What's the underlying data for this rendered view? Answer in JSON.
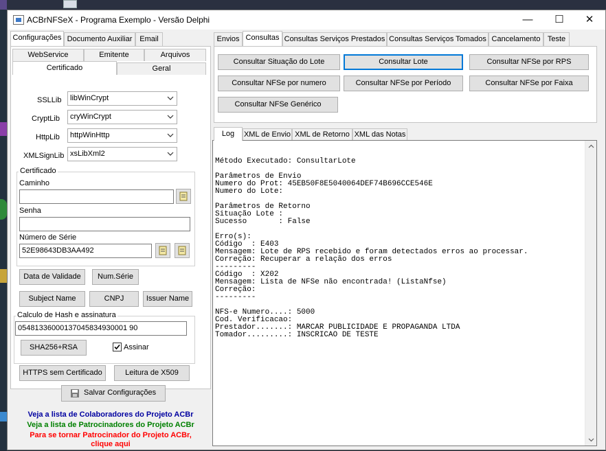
{
  "window": {
    "title": "ACBrNFSeX - Programa Exemplo - Versão Delphi",
    "minimize_glyph": "—",
    "maximize_glyph": "☐",
    "close_glyph": "✕"
  },
  "left": {
    "tabs": [
      "Configurações",
      "Documento Auxiliar",
      "Email"
    ],
    "subtabs_row1": [
      "WebService",
      "Emitente",
      "Arquivos"
    ],
    "subtabs_row2": [
      "Certificado",
      "Geral"
    ],
    "ssllib": {
      "label": "SSLLib",
      "value": "libWinCrypt"
    },
    "cryptlib": {
      "label": "CryptLib",
      "value": "cryWinCrypt"
    },
    "httplib": {
      "label": "HttpLib",
      "value": "httpWinHttp"
    },
    "xmlsignlib": {
      "label": "XMLSignLib",
      "value": "xsLibXml2"
    },
    "cert_group": "Certificado",
    "caminho_label": "Caminho",
    "caminho_value": "",
    "senha_label": "Senha",
    "senha_value": "",
    "serie_label": "Número de Série",
    "serie_value": "52E98643DB3AA492",
    "btn_validade": "Data de Validade",
    "btn_numserie": "Num.Série",
    "btn_subject": "Subject Name",
    "btn_cnpj": "CNPJ",
    "btn_issuer": "Issuer Name",
    "hash_group": "Calculo de Hash e assinatura",
    "hash_value": "05481336000137045834930001 90",
    "btn_sha": "SHA256+RSA",
    "assinar_label": "Assinar",
    "btn_https": "HTTPS sem Certificado",
    "btn_x509": "Leitura de X509",
    "btn_salvar": "Salvar Configurações",
    "link1": "Veja a lista de Colaboradores do Projeto ACBr",
    "link2": "Veja a lista de Patrocinadores do Projeto ACBr",
    "link3a": "Para se tornar Patrocinador do Projeto ACBr,",
    "link3b": "clique aqui"
  },
  "colors": {
    "link1": "#0000a0",
    "link2": "#008000",
    "link3": "#ff0000",
    "accent": "#0078d7"
  },
  "right": {
    "tabs": [
      "Envios",
      "Consultas",
      "Consultas Serviços Prestados",
      "Consultas Serviços Tomados",
      "Cancelamento",
      "Teste"
    ],
    "buttons": [
      "Consultar Situação do Lote",
      "Consultar Lote",
      "Consultar NFSe por RPS",
      "Consultar NFSe por numero",
      "Consultar NFSe por Período",
      "Consultar NFSe por Faixa",
      "Consultar NFSe Genérico"
    ],
    "log_tabs": [
      "Log",
      "XML de Envio",
      "XML de Retorno",
      "XML das Notas"
    ],
    "log_lines": [
      "Método Executado: ConsultarLote",
      "",
      "Parâmetros de Envio",
      "Numero do Prot: 45EB50F8E5040064DEF74B696CCE546E",
      "Numero do Lote:",
      "",
      "Parâmetros de Retorno",
      "Situação Lote :",
      "Sucesso       : False",
      "",
      "Erro(s):",
      "Código  : E403",
      "Mensagem: Lote de RPS recebido e foram detectados erros ao processar.",
      "Correção: Recuperar a relação dos erros",
      "---------",
      "Código  : X202",
      "Mensagem: Lista de NFSe não encontrada! (ListaNfse)",
      "Correção:",
      "---------",
      "",
      "NFS-e Numero....: 5000",
      "Cod. Verificacao:",
      "Prestador.......: MARCAR PUBLICIDADE E PROPAGANDA LTDA",
      "Tomador.........: INSCRICAO DE TESTE"
    ]
  }
}
